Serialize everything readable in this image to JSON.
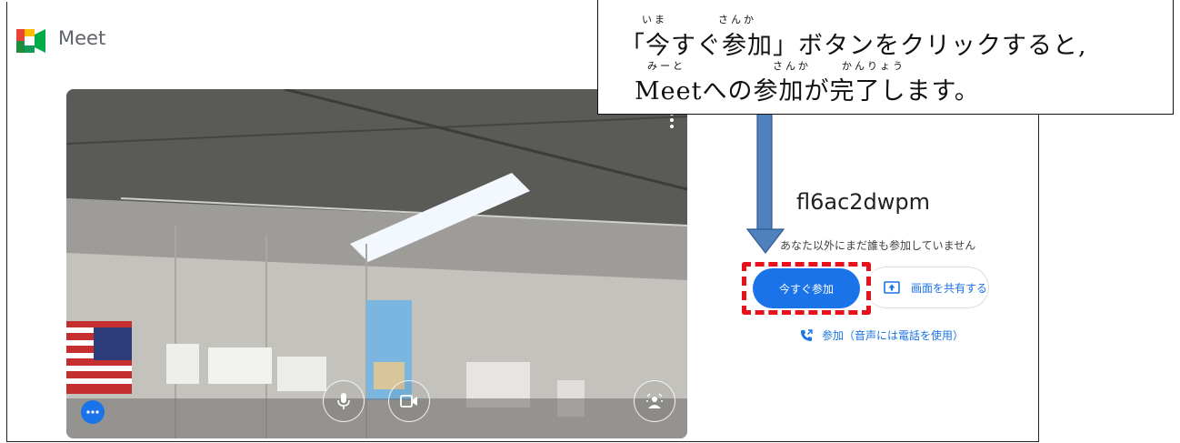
{
  "header": {
    "brand": "Meet",
    "logo_icon": "google-meet-logo-icon"
  },
  "video": {
    "more_icon": "more-vertical-icon",
    "controls": [
      {
        "name": "microphone-icon"
      },
      {
        "name": "camera-icon"
      },
      {
        "name": "visual-effects-icon"
      }
    ],
    "options_icon": "more-horizontal-icon"
  },
  "panel": {
    "meeting_code": "fl6ac2dwpm",
    "status": "あなた以外にまだ誰も参加していません",
    "join_now_label": "今すぐ参加",
    "share_screen_label": "画面を共有する",
    "join_phone_label": "参加（音声には電話を使用）"
  },
  "callout": {
    "line1": "「今すぐ参加」ボタンをクリックすると,",
    "line2": "Meetへの参加が完了します。",
    "ruby": {
      "ima": "いま",
      "sanka1": "さんか",
      "meet": "みーと",
      "sanka2": "さんか",
      "kanryou": "かんりょう"
    }
  },
  "colors": {
    "accent": "#1a73e8",
    "highlight": "#e8101b",
    "arrow": "#4f81bd"
  }
}
